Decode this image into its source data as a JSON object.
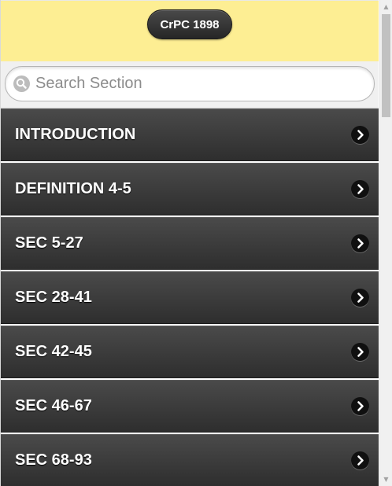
{
  "header": {
    "title_button": "CrPC 1898",
    "background_color": "#fdee93"
  },
  "search": {
    "placeholder": "Search Section",
    "value": "",
    "icon": "search-icon"
  },
  "list": {
    "items": [
      {
        "label": "INTRODUCTION",
        "icon": "chevron-right-icon"
      },
      {
        "label": "DEFINITION 4-5",
        "icon": "chevron-right-icon"
      },
      {
        "label": "SEC 5-27",
        "icon": "chevron-right-icon"
      },
      {
        "label": "SEC 28-41",
        "icon": "chevron-right-icon"
      },
      {
        "label": "SEC 42-45",
        "icon": "chevron-right-icon"
      },
      {
        "label": "SEC 46-67",
        "icon": "chevron-right-icon"
      },
      {
        "label": "SEC 68-93",
        "icon": "chevron-right-icon"
      }
    ]
  },
  "scrollbar": {
    "up_arrow": "▲",
    "down_arrow": "▼"
  }
}
